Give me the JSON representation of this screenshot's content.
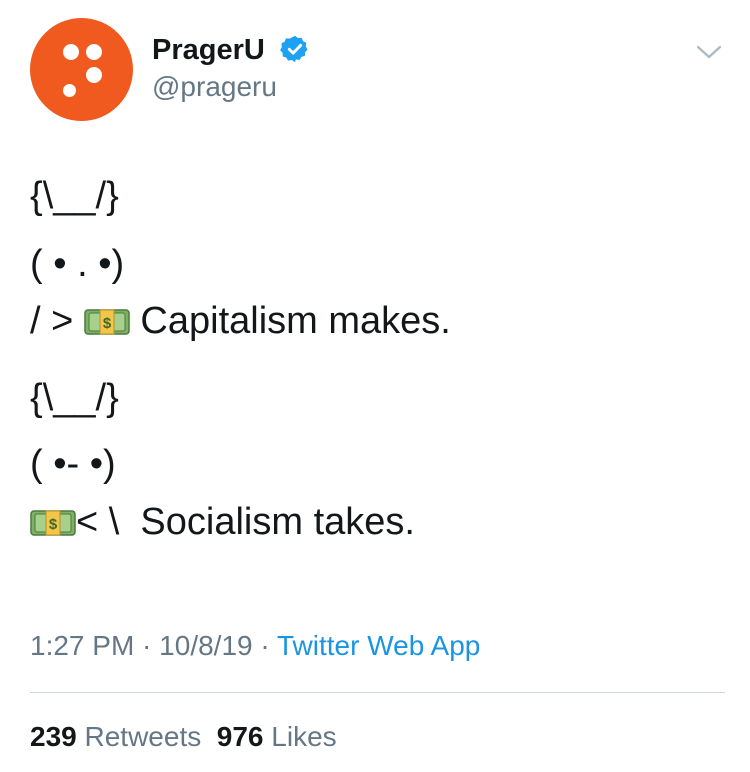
{
  "user": {
    "display_name": "PragerU",
    "handle": "@prageru",
    "brand_color": "#f05a1e",
    "verified_color": "#1da1f2"
  },
  "tweet": {
    "block1": {
      "line1": "{\\__/}",
      "line2": "( • . •)",
      "line3_prefix": "/ > ",
      "line3_text": " Capitalism makes."
    },
    "block2": {
      "line1": "{\\__/}",
      "line2": "( •- •)",
      "line3_prefix": "< \\  ",
      "line3_text": "Socialism takes."
    },
    "emoji_icon": "money-bag-icon"
  },
  "meta": {
    "time": "1:27 PM",
    "sep1": " · ",
    "date": "10/8/19",
    "sep2": " · ",
    "source": "Twitter Web App"
  },
  "stats": {
    "retweets_count": "239",
    "retweets_label": "Retweets",
    "likes_count": "976",
    "likes_label": "Likes"
  }
}
